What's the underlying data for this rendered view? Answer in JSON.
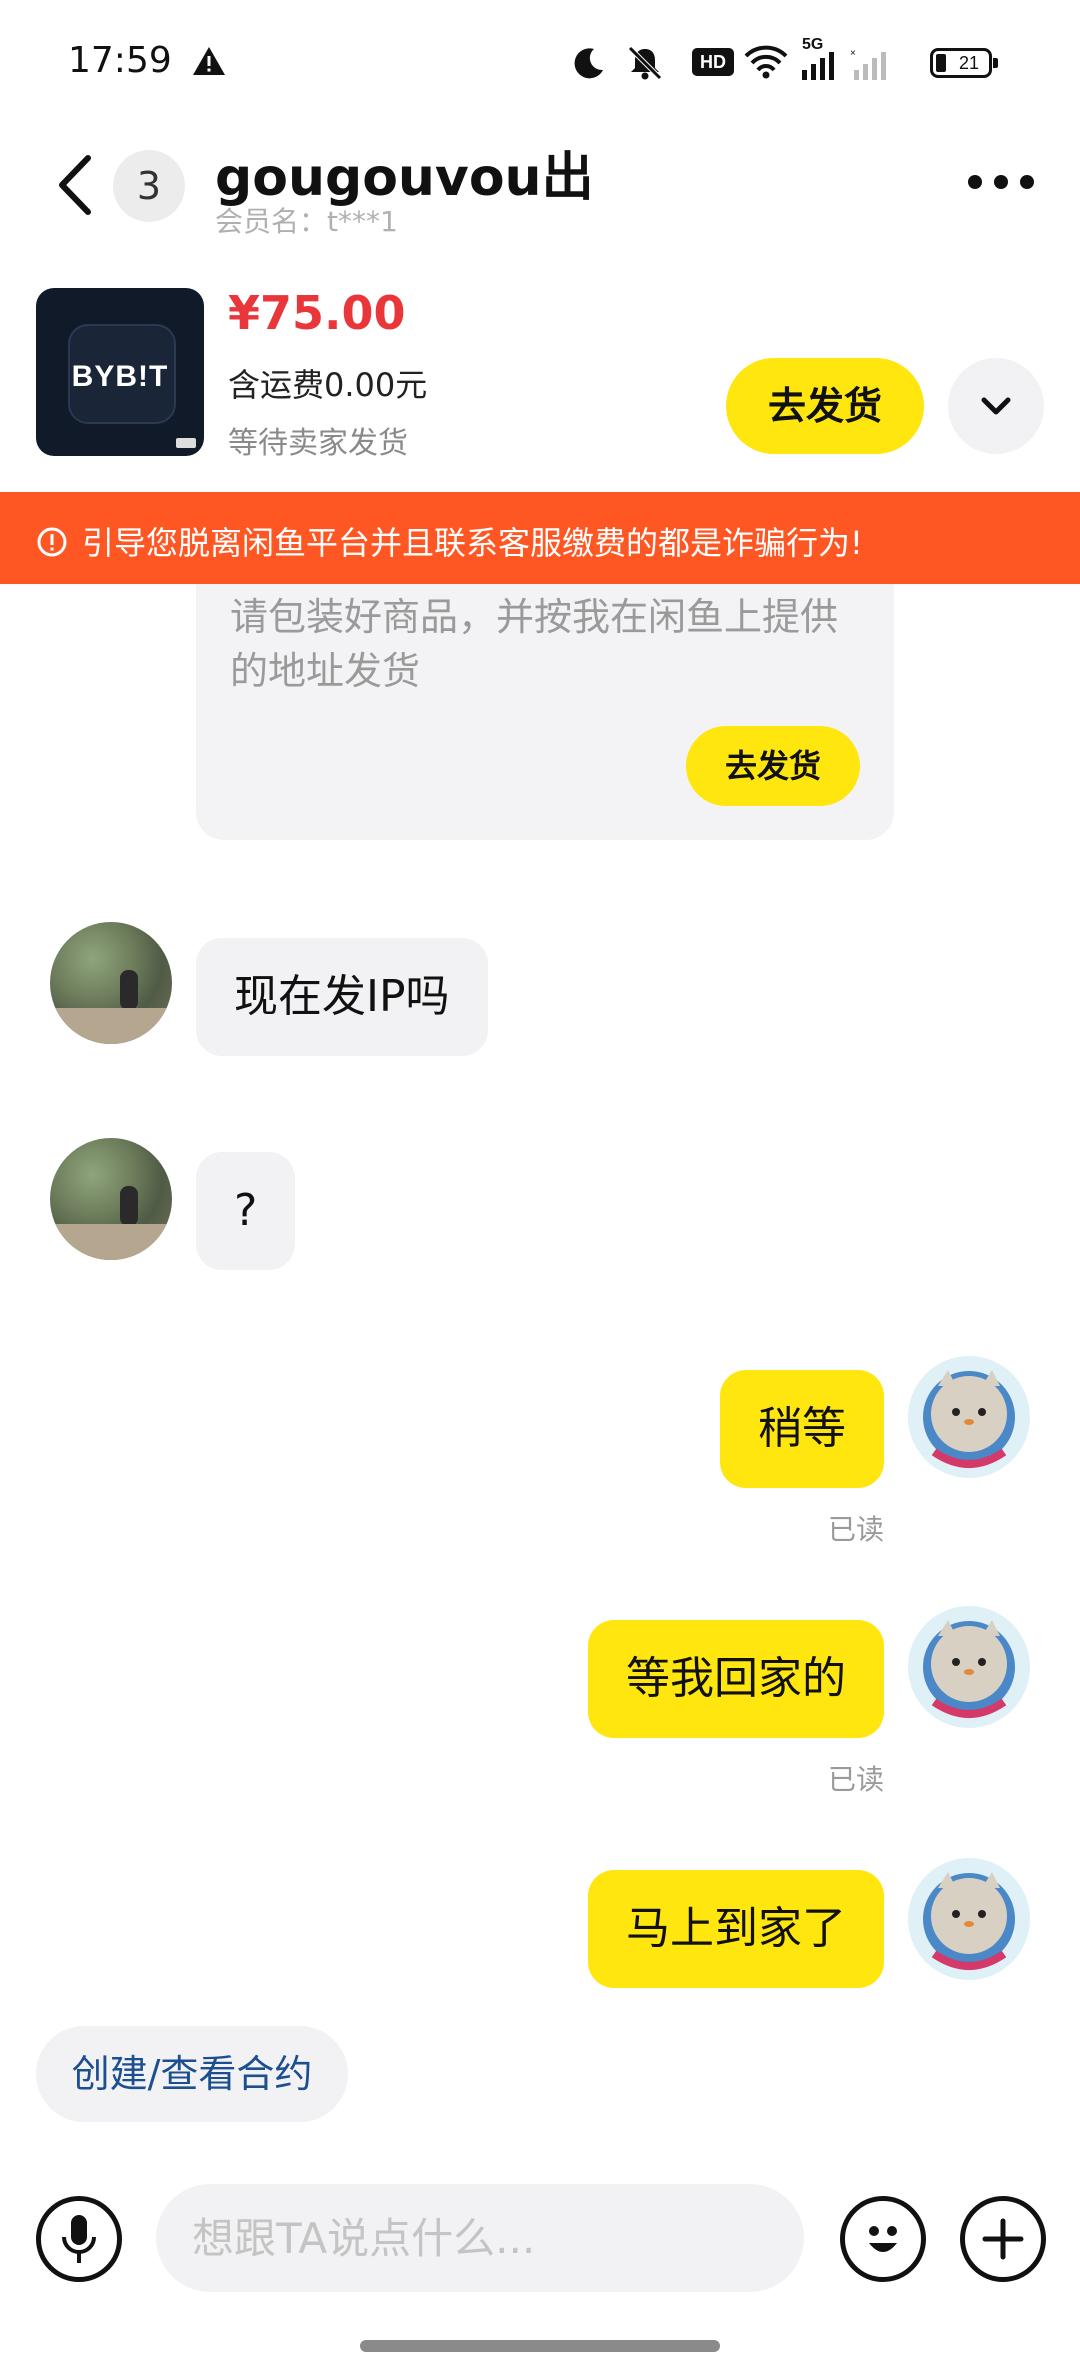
{
  "status_bar": {
    "time": "17:59",
    "network": "5G",
    "hd_label": "HD",
    "battery": "21",
    "icons": [
      "warning-icon",
      "moon-icon",
      "mute-bell-icon",
      "hd-icon",
      "wifi-icon",
      "signal-icon",
      "battery-icon"
    ]
  },
  "header": {
    "back_icon": "chevron-left-icon",
    "unread_count": "3",
    "title": "gougouvou出",
    "subtitle": "会员名：t***1",
    "more_icon": "more-dots-icon"
  },
  "product": {
    "image_logo_text": "BYB!T",
    "price": "¥75.00",
    "shipping": "含运费0.00元",
    "status": "等待卖家发货",
    "ship_button": "去发货",
    "expand_icon": "chevron-down-icon"
  },
  "warning_banner": {
    "icon": "alert-circle-icon",
    "text": "引导您脱离闲鱼平台并且联系客服缴费的都是诈骗行为!",
    "color": "#ff5723"
  },
  "system_card": {
    "text": "请包装好商品，并按我在闲鱼上提供的地址发货",
    "button": "去发货"
  },
  "messages": [
    {
      "side": "in",
      "text": "现在发IP吗"
    },
    {
      "side": "in",
      "text": "?"
    },
    {
      "side": "out",
      "text": "稍等",
      "status": "已读"
    },
    {
      "side": "out",
      "text": "等我回家的",
      "status": "已读"
    },
    {
      "side": "out",
      "text": "马上到家了"
    }
  ],
  "contract_chip": "创建/查看合约",
  "input_bar": {
    "placeholder": "想跟TA说点什么...",
    "mic_icon": "microphone-icon",
    "emoji_icon": "emoji-icon",
    "plus_icon": "plus-icon"
  },
  "colors": {
    "accent_yellow": "#ffe60f",
    "price_red": "#e8363a",
    "banner_orange": "#ff5723",
    "link_blue": "#1c4f8f"
  }
}
